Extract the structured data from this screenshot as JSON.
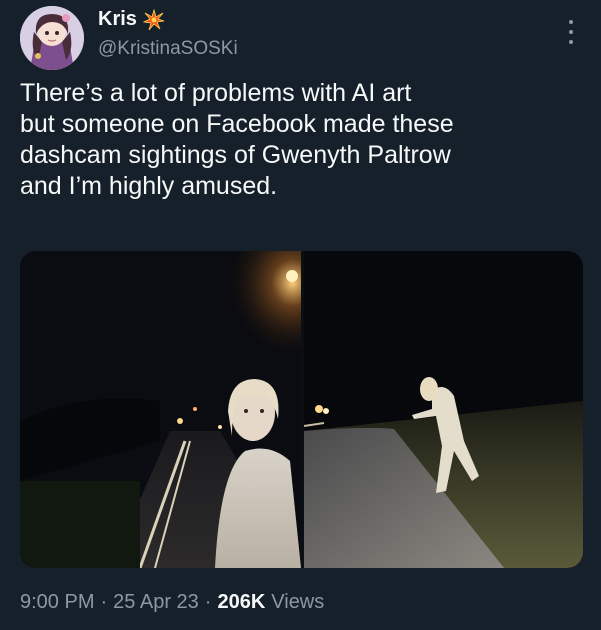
{
  "author": {
    "display_name": "Kris",
    "handle": "@KristinaSOSKi",
    "badge_icon": "sparkle-burst-icon",
    "avatar_icon": "anime-character-avatar"
  },
  "tweet": {
    "text": "There’s a lot of problems with AI art\nbut someone on Facebook made these\ndashcam sightings of Gwenyth Paltrow\nand I’m highly amused."
  },
  "media": [
    {
      "description": "night dashcam road image, figure close to camera",
      "index": 1
    },
    {
      "description": "night dashcam road image, figure crouching at roadside",
      "index": 2
    }
  ],
  "footer": {
    "time": "9:00 PM",
    "date": "25 Apr 23",
    "views_count": "206K",
    "views_label": "Views",
    "separator": "·"
  },
  "colors": {
    "background": "#15202b",
    "text_primary": "#f7f9f9",
    "text_secondary": "#8b98a5",
    "badge": "#f4511e"
  }
}
